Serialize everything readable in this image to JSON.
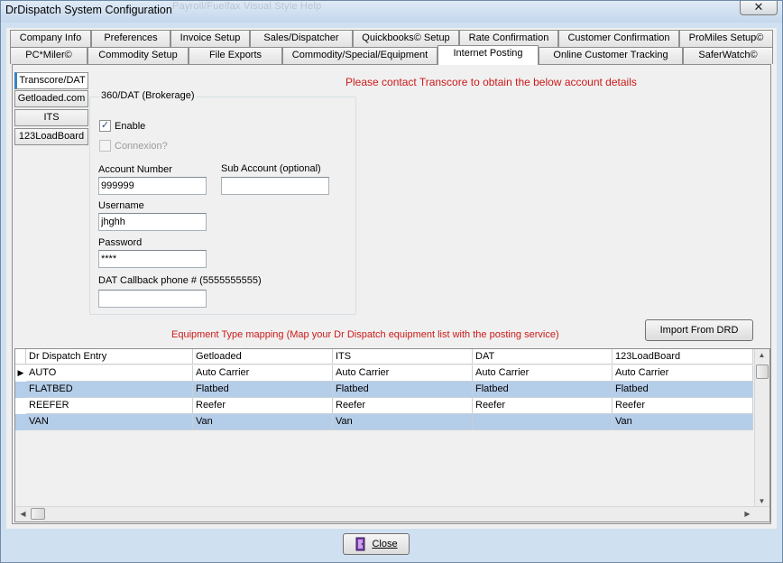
{
  "window": {
    "title": "DrDispatch  System Configuration",
    "ghost_menu": "Payroll/Fuelfax   Visual Style   Help",
    "close_glyph": "✕"
  },
  "tabs_row1": [
    {
      "label": "Company Info"
    },
    {
      "label": "Preferences"
    },
    {
      "label": "Invoice Setup"
    },
    {
      "label": "Sales/Dispatcher"
    },
    {
      "label": "Quickbooks© Setup"
    },
    {
      "label": "Rate Confirmation"
    },
    {
      "label": "Customer Confirmation"
    },
    {
      "label": "ProMiles Setup©"
    }
  ],
  "tabs_row2": [
    {
      "label": "PC*Miler©"
    },
    {
      "label": "Commodity Setup"
    },
    {
      "label": "File Exports"
    },
    {
      "label": "Commodity/Special/Equipment"
    },
    {
      "label": "Internet Posting",
      "active": true
    },
    {
      "label": "Online Customer Tracking"
    },
    {
      "label": "SaferWatch©"
    }
  ],
  "side_tabs": [
    {
      "label": "Transcore/DAT",
      "active": true
    },
    {
      "label": "Getloaded.com"
    },
    {
      "label": "ITS"
    },
    {
      "label": "123LoadBoard"
    }
  ],
  "contact_message": "Please contact Transcore to obtain the below account details",
  "dat_group": {
    "label": "360/DAT (Brokerage)",
    "enable_label": "Enable",
    "enable_checked": true,
    "connexion_label": "Connexion?",
    "connexion_checked": false,
    "account_number_label": "Account Number",
    "account_number_value": "999999",
    "sub_account_label": "Sub Account (optional)",
    "sub_account_value": "",
    "username_label": "Username",
    "username_value": "jhghh",
    "password_label": "Password",
    "password_value": "****",
    "callback_label": "DAT Callback phone # (5555555555)",
    "callback_value": ""
  },
  "mapping_message": "Equipment Type mapping (Map your Dr Dispatch equipment list with the posting service)",
  "import_button": "Import From DRD",
  "grid": {
    "columns": [
      "Dr Dispatch Entry",
      "Getloaded",
      "ITS",
      "DAT",
      "123LoadBoard"
    ],
    "rows": [
      [
        "AUTO",
        "Auto Carrier",
        "Auto Carrier",
        "Auto Carrier",
        "Auto Carrier"
      ],
      [
        "FLATBED",
        "Flatbed",
        "Flatbed",
        "Flatbed",
        "Flatbed"
      ],
      [
        "REEFER",
        "Reefer",
        "Reefer",
        "Reefer",
        "Reefer"
      ],
      [
        "VAN",
        "Van",
        "Van",
        "",
        "Van"
      ]
    ],
    "current_row_marker": "▶"
  },
  "close_button": "Close",
  "colors": {
    "accent_red": "#cc1a1a",
    "selected_row": "#b4cde9",
    "window_frame": "#cfe0f1"
  }
}
